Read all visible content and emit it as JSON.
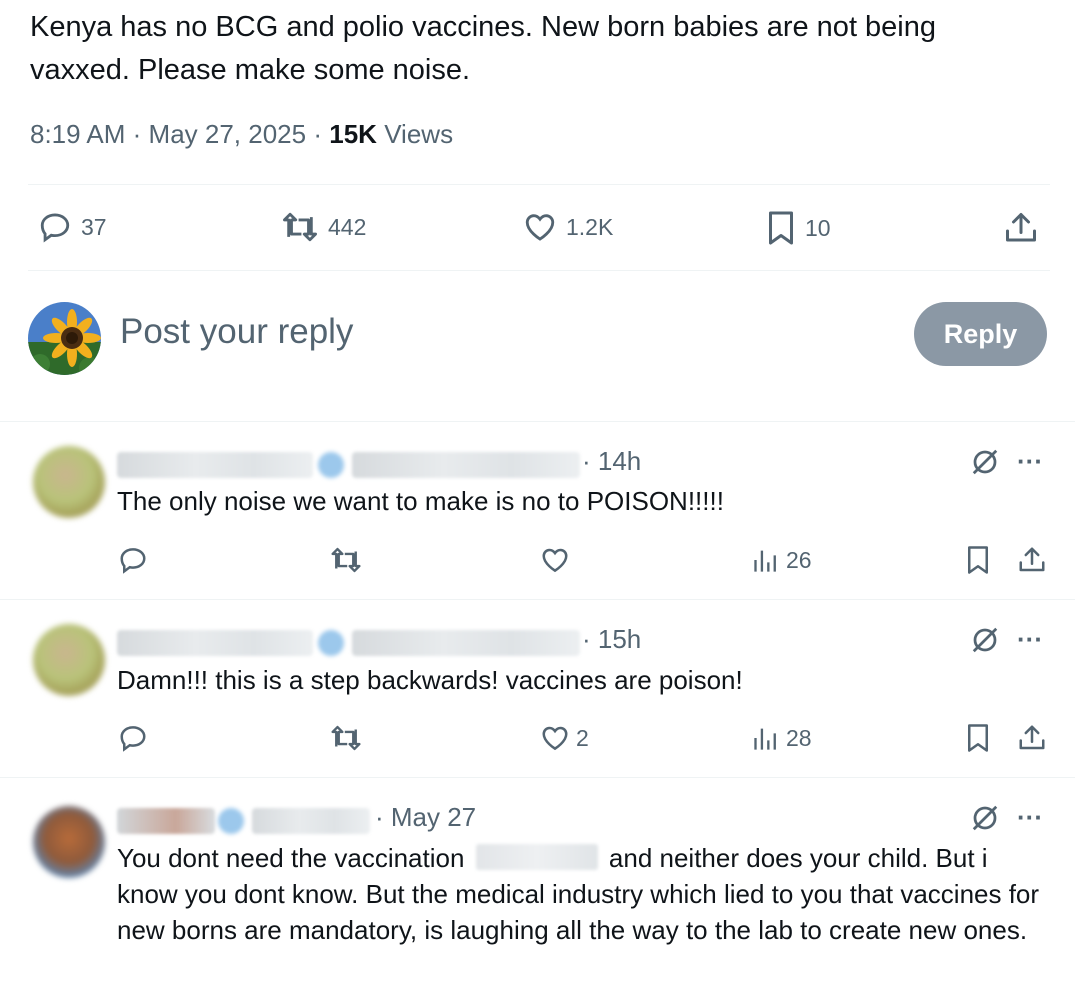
{
  "tweet": {
    "text": "Kenya has no BCG and polio vaccines. New born babies are not being vaxxed. Please make some noise.",
    "time": "8:19 AM",
    "date": "May 27, 2025",
    "views_count": "15K",
    "views_label": "Views",
    "separator": "·"
  },
  "actions": {
    "replies": "37",
    "reposts": "442",
    "likes": "1.2K",
    "bookmarks": "10"
  },
  "composer": {
    "placeholder": "Post your reply",
    "button_label": "Reply"
  },
  "comments": [
    {
      "time": "· 14h",
      "text": "The only noise we want to make is no to POISON!!!!!",
      "likes": "",
      "views": "26"
    },
    {
      "time": "· 15h",
      "text": "Damn!!! this is a step backwards! vaccines are poison!",
      "likes": "2",
      "views": "28"
    },
    {
      "time": "· May 27",
      "text_before": "You dont need the vaccination",
      "text_after": "and neither does your child. But i know you dont know. But the medical industry which lied to you that vaccines for new borns are mandatory,  is laughing all the way to the lab to create new ones."
    }
  ],
  "colors": {
    "text": "#0f1419",
    "secondary": "#536471",
    "reply_button": "#8b98a5",
    "divider": "#eff3f4"
  }
}
